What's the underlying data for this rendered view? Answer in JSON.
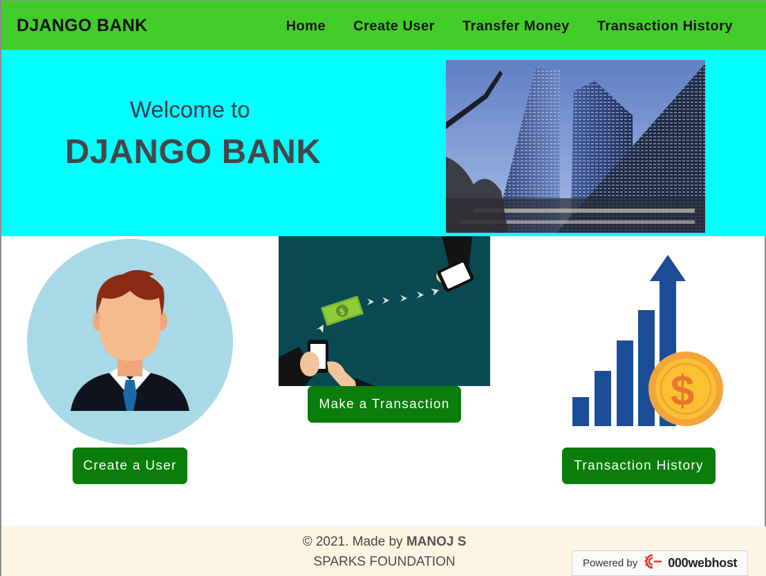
{
  "navbar": {
    "brand": "DJANGO BANK",
    "links": [
      {
        "label": "Home"
      },
      {
        "label": "Create User"
      },
      {
        "label": "Transfer Money"
      },
      {
        "label": "Transaction History"
      }
    ]
  },
  "hero": {
    "welcome": "Welcome to",
    "title": "DJANGO BANK"
  },
  "actions": {
    "create_user": "Create a User",
    "make_transaction": "Make a Transaction",
    "transaction_history": "Transaction History"
  },
  "footer": {
    "copyright": "© 2021. Made by ",
    "author": "MANOJ S",
    "org": "SPARKS FOUNDATION"
  },
  "badge": {
    "label": "Powered by",
    "brand": "000webhost"
  },
  "colors": {
    "navbar": "#43cd2a",
    "hero": "#00ffff",
    "button": "#0a7d0a",
    "footer": "#fdf4e4"
  }
}
